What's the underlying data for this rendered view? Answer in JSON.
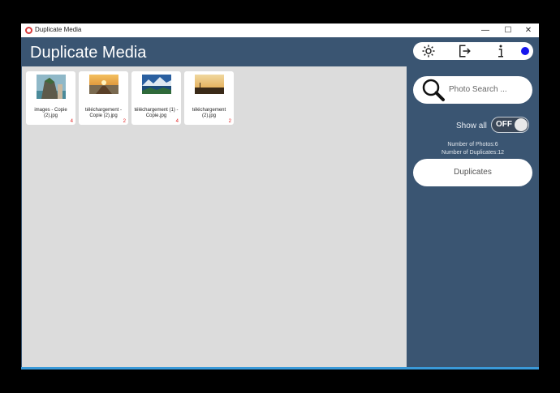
{
  "window": {
    "title": "Duplicate Media",
    "controls": {
      "minimize": "—",
      "maximize": "☐",
      "close": "✕"
    }
  },
  "header": {
    "title": "Duplicate Media"
  },
  "toolbar": {
    "icons": [
      "gear-icon",
      "exit-icon",
      "info-icon"
    ],
    "status_color": "#1515ee"
  },
  "search": {
    "placeholder": "Photo Search ..."
  },
  "show_all": {
    "label": "Show all",
    "state": "OFF"
  },
  "stats": {
    "photos": "Number of Photos:6",
    "duplicates": "Number of Duplicates:12"
  },
  "duplicates_button": {
    "label": "Duplicates"
  },
  "cards": [
    {
      "name": "images - Copie (2).jpg",
      "count": "4",
      "thumb": "rock-island"
    },
    {
      "name": "téléchargement - Copie (2).jpg",
      "count": "2",
      "thumb": "sunset-pier"
    },
    {
      "name": "téléchargement (1) - Copie.jpg",
      "count": "4",
      "thumb": "mountain-lake"
    },
    {
      "name": "téléchargement (2).jpg",
      "count": "2",
      "thumb": "desert-sunset"
    }
  ],
  "colors": {
    "header": "#3a5572",
    "content": "#dcdcdc",
    "accent_line": "#3a9ad9",
    "count_red": "#e02020"
  }
}
